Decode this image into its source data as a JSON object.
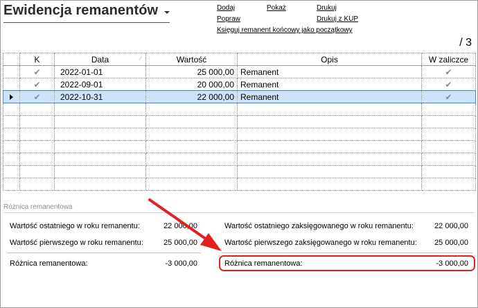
{
  "header": {
    "title": "Ewidencja remanentów"
  },
  "toolbar": {
    "add": "Dodaj",
    "show": "Pokaż",
    "print": "Drukuj",
    "edit": "Popraw",
    "print_kup": "Drukuj z KUP",
    "book_final": "Księguj remanent końcowy jako początkowy"
  },
  "pager": {
    "text": "/ 3"
  },
  "table": {
    "columns": [
      "K",
      "Data",
      "Wartość",
      "Opis",
      "W zaliczce"
    ],
    "rows": [
      {
        "k": "✔",
        "date": "2022-01-01",
        "value": "25 000,00",
        "desc": "Remanent",
        "advance": "✔"
      },
      {
        "k": "✔",
        "date": "2022-09-01",
        "value": "20 000,00",
        "desc": "Remanent",
        "advance": "✔"
      },
      {
        "k": "✔",
        "date": "2022-10-31",
        "value": "22 000,00",
        "desc": "Remanent",
        "advance": "✔"
      }
    ]
  },
  "difference": {
    "section_title": "Różnica remanentowa",
    "last_label": "Wartość ostatniego w roku remanentu:",
    "last_value": "22 000,00",
    "first_label": "Wartość pierwszego w roku remanentu:",
    "first_value": "25 000,00",
    "diff_label": "Różnica remanentowa:",
    "diff_value": "-3 000,00",
    "last_booked_label": "Wartość ostatniego zaksięgowanego w roku remanentu:",
    "last_booked_value": "22 000,00",
    "first_booked_label": "Wartość pierwszego zaksięgowanego w roku remanentu:",
    "first_booked_value": "25 000,00",
    "diff_booked_label": "Różnica remanentowa:",
    "diff_booked_value": "-3 000,00"
  },
  "colors": {
    "selection": "#cde3f7",
    "annotation": "#e32020"
  }
}
